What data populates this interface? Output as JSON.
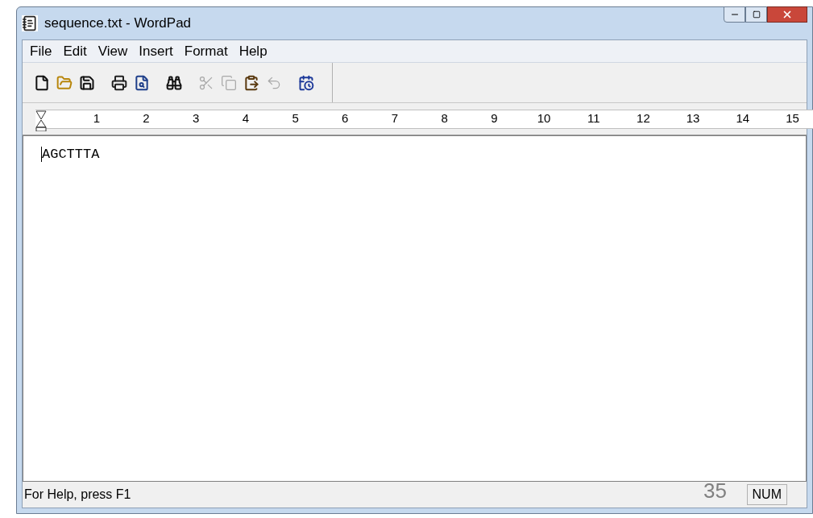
{
  "window": {
    "title": "sequence.txt - WordPad"
  },
  "menu": [
    "File",
    "Edit",
    "View",
    "Insert",
    "Format",
    "Help"
  ],
  "toolbar": [
    {
      "kind": "new",
      "disabled": false
    },
    {
      "kind": "open",
      "disabled": false
    },
    {
      "kind": "save",
      "disabled": false
    },
    {
      "kind": "gap"
    },
    {
      "kind": "print",
      "disabled": false
    },
    {
      "kind": "preview",
      "disabled": false
    },
    {
      "kind": "gap"
    },
    {
      "kind": "find",
      "disabled": false
    },
    {
      "kind": "gap"
    },
    {
      "kind": "cut",
      "disabled": true
    },
    {
      "kind": "copy",
      "disabled": true
    },
    {
      "kind": "paste",
      "disabled": false
    },
    {
      "kind": "undo",
      "disabled": true
    },
    {
      "kind": "gap"
    },
    {
      "kind": "datetime",
      "disabled": false
    }
  ],
  "ruler": [
    "1",
    "2",
    "3",
    "4",
    "5",
    "6",
    "7",
    "8",
    "9",
    "10",
    "11",
    "12",
    "13",
    "14",
    "15"
  ],
  "document": {
    "text": "AGCTTTA"
  },
  "status_bar": {
    "help": "For Help, press F1",
    "page_number": "35",
    "num": "NUM"
  }
}
